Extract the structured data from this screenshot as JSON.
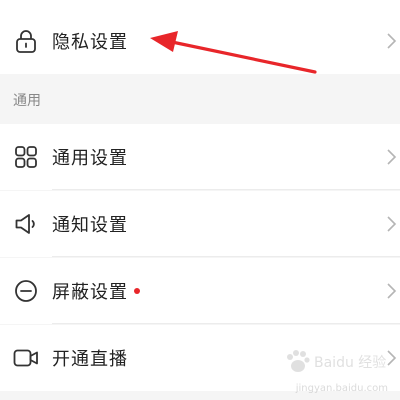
{
  "rows": {
    "privacy": {
      "label": "隐私设置",
      "icon": "lock-icon"
    },
    "general": {
      "label": "通用设置",
      "icon": "grid-icon"
    },
    "notification": {
      "label": "通知设置",
      "icon": "speaker-icon"
    },
    "block": {
      "label": "屏蔽设置",
      "icon": "minus-circle-icon"
    },
    "live": {
      "label": "开通直播",
      "icon": "video-camera-icon"
    }
  },
  "section": {
    "general_header": "通用"
  },
  "watermark": {
    "brand": "Baidu 经验",
    "url": "jingyan.baidu.com"
  },
  "colors": {
    "accent_red": "#e8262a",
    "text": "#222222",
    "secondary_text": "#888888",
    "background": "#f5f5f5",
    "row_background": "#ffffff"
  }
}
